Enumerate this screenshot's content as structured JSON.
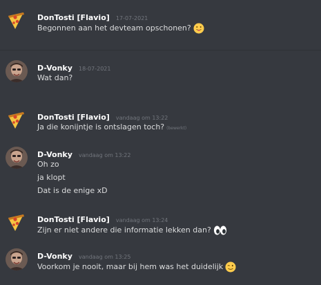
{
  "messages": [
    {
      "username": "DonTosti [Flavio]",
      "timestamp": "17-07-2021",
      "avatar_icon": "pizza-icon",
      "lines": [
        {
          "text": "Begonnen aan het devteam opschonen?",
          "emoji": "tongue-face-emoji"
        }
      ]
    },
    {
      "username": "D-Vonky",
      "timestamp": "18-07-2021",
      "avatar_icon": "portrait-avatar",
      "lines": [
        {
          "text": "Wat dan?"
        }
      ]
    },
    {
      "username": "DonTosti [Flavio]",
      "timestamp": "vandaag om 13:22",
      "avatar_icon": "pizza-icon",
      "lines": [
        {
          "text": "Ja die konijntje is ontslagen toch?",
          "edited": "(bewerkt)"
        }
      ]
    },
    {
      "username": "D-Vonky",
      "timestamp": "vandaag om 13:22",
      "avatar_icon": "portrait-avatar",
      "lines": [
        {
          "text": "Oh zo"
        },
        {
          "text": "ja klopt"
        },
        {
          "text": "Dat is de enige xD"
        }
      ]
    },
    {
      "username": "DonTosti [Flavio]",
      "timestamp": "vandaag om 13:24",
      "avatar_icon": "pizza-icon",
      "lines": [
        {
          "text": "Zijn er niet andere die informatie lekken dan?",
          "emoji": "eyes-emoji"
        }
      ]
    },
    {
      "username": "D-Vonky",
      "timestamp": "vandaag om 13:25",
      "avatar_icon": "portrait-avatar",
      "lines": [
        {
          "text": "Voorkom je nooit, maar bij hem was het duidelijk",
          "emoji": "wink-face-emoji"
        }
      ]
    }
  ],
  "colors": {
    "background": "#36393f",
    "username": "#ffffff",
    "text": "#dcddde",
    "timestamp": "#72767d",
    "divider": "#2f3136"
  }
}
